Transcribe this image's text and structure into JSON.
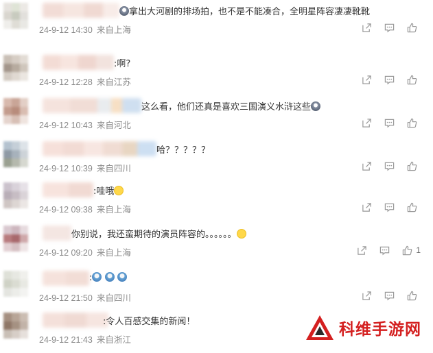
{
  "comments": [
    {
      "text_pre": "",
      "text": "拿出大河剧的排场拍，也不是不能凑合，全明星阵容凄凄靴靴",
      "date": "24-9-12 14:30",
      "loc": "来自上海",
      "likes": ""
    },
    {
      "text_pre": "",
      "text": ":啊?",
      "date": "24-9-12 12:28",
      "loc": "来自江苏",
      "likes": ""
    },
    {
      "text_pre": "",
      "text": "这么看，他们还真是喜欢三国演义水浒这些",
      "date": "24-9-12 10:43",
      "loc": "来自河北",
      "likes": ""
    },
    {
      "text_pre": "",
      "text": "哈？？？？？",
      "date": "24-9-12 10:39",
      "loc": "来自四川",
      "likes": ""
    },
    {
      "text_pre": "",
      "text": ":哇哦",
      "date": "24-9-12 09:38",
      "loc": "来自上海",
      "likes": ""
    },
    {
      "text_pre": "",
      "text": "你别说，我还蛮期待的演员阵容的。。。。。。",
      "date": "24-9-12 09:20",
      "loc": "来自上海",
      "likes": "1"
    },
    {
      "text_pre": "",
      "text": ":",
      "date": "24-9-12 21:50",
      "loc": "来自四川",
      "likes": ""
    },
    {
      "text_pre": "",
      "text": ":令人百感交集的新闻！",
      "date": "24-9-12 21:43",
      "loc": "来自浙江",
      "likes": ""
    }
  ],
  "icons": {
    "share": "share-icon",
    "comment": "comment-icon",
    "like": "like-icon"
  },
  "watermark": {
    "text": "科维手游网"
  },
  "colors": {
    "meta": "#8a8a8a",
    "icon": "#999999",
    "brand": "#d42020"
  }
}
